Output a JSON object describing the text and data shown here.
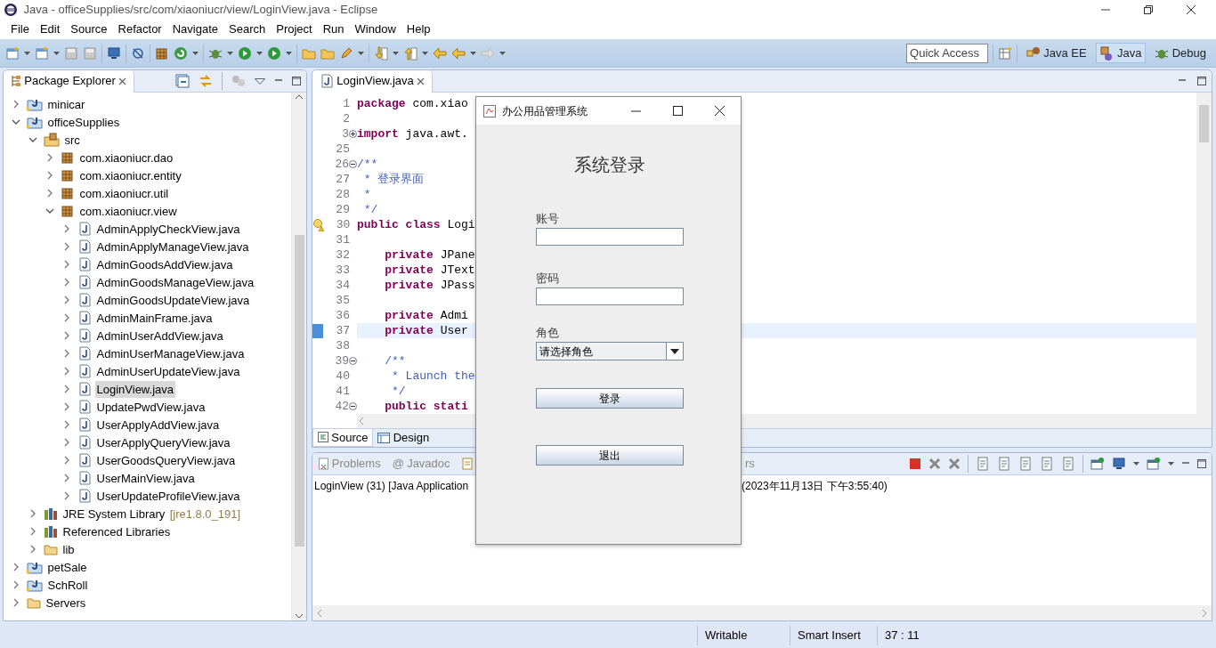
{
  "window": {
    "title": "Java - officeSupplies/src/com/xiaoniucr/view/LoginView.java - Eclipse"
  },
  "menu": [
    "File",
    "Edit",
    "Source",
    "Refactor",
    "Navigate",
    "Search",
    "Project",
    "Run",
    "Window",
    "Help"
  ],
  "quick_access": {
    "placeholder": "Quick Access"
  },
  "perspectives": [
    {
      "label": "Java EE",
      "selected": false
    },
    {
      "label": "Java",
      "selected": true
    },
    {
      "label": "Debug",
      "selected": false
    }
  ],
  "package_explorer": {
    "title": "Package Explorer",
    "tree": [
      {
        "label": "minicar",
        "kind": "project",
        "expanded": false,
        "selected": false
      },
      {
        "label": "officeSupplies",
        "kind": "project",
        "expanded": true,
        "selected": false,
        "children": [
          {
            "label": "src",
            "kind": "source",
            "expanded": true,
            "selected": false,
            "children": [
              {
                "label": "com.xiaoniucr.dao",
                "kind": "package",
                "expanded": false,
                "selected": false
              },
              {
                "label": "com.xiaoniucr.entity",
                "kind": "package",
                "expanded": false,
                "selected": false
              },
              {
                "label": "com.xiaoniucr.util",
                "kind": "package",
                "expanded": false,
                "selected": false
              },
              {
                "label": "com.xiaoniucr.view",
                "kind": "package",
                "expanded": true,
                "selected": false,
                "children": [
                  {
                    "label": "AdminApplyCheckView.java",
                    "kind": "java",
                    "expanded": false,
                    "selected": false
                  },
                  {
                    "label": "AdminApplyManageView.java",
                    "kind": "java",
                    "expanded": false,
                    "selected": false
                  },
                  {
                    "label": "AdminGoodsAddView.java",
                    "kind": "java",
                    "expanded": false,
                    "selected": false
                  },
                  {
                    "label": "AdminGoodsManageView.java",
                    "kind": "java",
                    "expanded": false,
                    "selected": false
                  },
                  {
                    "label": "AdminGoodsUpdateView.java",
                    "kind": "java",
                    "expanded": false,
                    "selected": false
                  },
                  {
                    "label": "AdminMainFrame.java",
                    "kind": "java",
                    "expanded": false,
                    "selected": false
                  },
                  {
                    "label": "AdminUserAddView.java",
                    "kind": "java",
                    "expanded": false,
                    "selected": false
                  },
                  {
                    "label": "AdminUserManageView.java",
                    "kind": "java",
                    "expanded": false,
                    "selected": false
                  },
                  {
                    "label": "AdminUserUpdateView.java",
                    "kind": "java",
                    "expanded": false,
                    "selected": false
                  },
                  {
                    "label": "LoginView.java",
                    "kind": "java",
                    "expanded": false,
                    "selected": true
                  },
                  {
                    "label": "UpdatePwdView.java",
                    "kind": "java",
                    "expanded": false,
                    "selected": false
                  },
                  {
                    "label": "UserApplyAddView.java",
                    "kind": "java",
                    "expanded": false,
                    "selected": false
                  },
                  {
                    "label": "UserApplyQueryView.java",
                    "kind": "java",
                    "expanded": false,
                    "selected": false
                  },
                  {
                    "label": "UserGoodsQueryView.java",
                    "kind": "java",
                    "expanded": false,
                    "selected": false
                  },
                  {
                    "label": "UserMainView.java",
                    "kind": "java",
                    "expanded": false,
                    "selected": false
                  },
                  {
                    "label": "UserUpdateProfileView.java",
                    "kind": "java",
                    "expanded": false,
                    "selected": false
                  }
                ]
              }
            ]
          },
          {
            "label": "JRE System Library",
            "decoration": "[jre1.8.0_191]",
            "kind": "library",
            "expanded": false,
            "selected": false
          },
          {
            "label": "Referenced Libraries",
            "kind": "library",
            "expanded": false,
            "selected": false
          },
          {
            "label": "lib",
            "kind": "folder",
            "expanded": false,
            "selected": false
          }
        ]
      },
      {
        "label": "petSale",
        "kind": "project",
        "expanded": false,
        "selected": false
      },
      {
        "label": "SchRoll",
        "kind": "project",
        "expanded": false,
        "selected": false
      },
      {
        "label": "Servers",
        "kind": "folder",
        "expanded": false,
        "selected": false
      }
    ]
  },
  "editor": {
    "tab": "LoginView.java",
    "lines": [
      {
        "n": "1",
        "tokens": [
          {
            "kind": "keyword",
            "text": "package"
          },
          {
            "kind": "plain",
            "text": " com.xiao"
          }
        ]
      },
      {
        "n": "2"
      },
      {
        "n": "3",
        "collapsed": true,
        "tokens": [
          {
            "kind": "keyword",
            "text": "import"
          },
          {
            "kind": "plain",
            "text": " java.awt."
          }
        ]
      },
      {
        "n": "25"
      },
      {
        "n": "26",
        "collapsed": false,
        "tokens": [
          {
            "kind": "comment",
            "text": "/**"
          }
        ]
      },
      {
        "n": "27",
        "tokens": [
          {
            "kind": "comment",
            "text": " * 登录界面"
          }
        ]
      },
      {
        "n": "28",
        "tokens": [
          {
            "kind": "comment",
            "text": " *"
          }
        ]
      },
      {
        "n": "29",
        "tokens": [
          {
            "kind": "comment",
            "text": " */"
          }
        ]
      },
      {
        "n": "30",
        "warning": true,
        "tokens": [
          {
            "kind": "keyword",
            "text": "public class"
          },
          {
            "kind": "plain",
            "text": " Logi"
          }
        ]
      },
      {
        "n": "31"
      },
      {
        "n": "32",
        "tokens": [
          {
            "kind": "keyword",
            "text": "    private"
          },
          {
            "kind": "plain",
            "text": " JPane"
          }
        ]
      },
      {
        "n": "33",
        "tokens": [
          {
            "kind": "keyword",
            "text": "    private"
          },
          {
            "kind": "plain",
            "text": " JText"
          }
        ]
      },
      {
        "n": "34",
        "tokens": [
          {
            "kind": "keyword",
            "text": "    private"
          },
          {
            "kind": "plain",
            "text": " JPass"
          }
        ]
      },
      {
        "n": "35"
      },
      {
        "n": "36",
        "tokens": [
          {
            "kind": "keyword",
            "text": "    private"
          },
          {
            "kind": "plain",
            "text": " Admi"
          }
        ]
      },
      {
        "n": "37",
        "current": true,
        "tokens": [
          {
            "kind": "keyword",
            "text": "    private"
          },
          {
            "kind": "plain",
            "text": " User"
          }
        ]
      },
      {
        "n": "38"
      },
      {
        "n": "39",
        "collapsed": false,
        "tokens": [
          {
            "kind": "comment",
            "text": "    /**"
          }
        ]
      },
      {
        "n": "40",
        "tokens": [
          {
            "kind": "comment",
            "text": "     * Launch the"
          }
        ]
      },
      {
        "n": "41",
        "tokens": [
          {
            "kind": "comment",
            "text": "     */"
          }
        ]
      },
      {
        "n": "42",
        "collapsed": false,
        "tokens": [
          {
            "kind": "keyword",
            "text": "    public stati"
          }
        ]
      }
    ],
    "bottom_tabs": [
      {
        "label": "Source",
        "selected": true
      },
      {
        "label": "Design",
        "selected": false
      }
    ]
  },
  "console": {
    "tabs": [
      {
        "label": "Problems"
      },
      {
        "label": "Javadoc",
        "icon_char": "@"
      }
    ],
    "partial_tab": "rs",
    "line_start": "LoginView (31) [Java Application",
    "line_end": "(2023年11月13日 下午3:55:40)"
  },
  "status_bar": [
    "Writable",
    "Smart Insert",
    "37 : 11"
  ],
  "dialog": {
    "title": "办公用品管理系统",
    "heading": "系统登录",
    "fields": [
      {
        "label": "账号",
        "kind": "text"
      },
      {
        "label": "密码",
        "kind": "password"
      },
      {
        "label": "角色",
        "kind": "combo",
        "value": "请选择角色"
      }
    ],
    "buttons": [
      "登录",
      "退出"
    ]
  }
}
